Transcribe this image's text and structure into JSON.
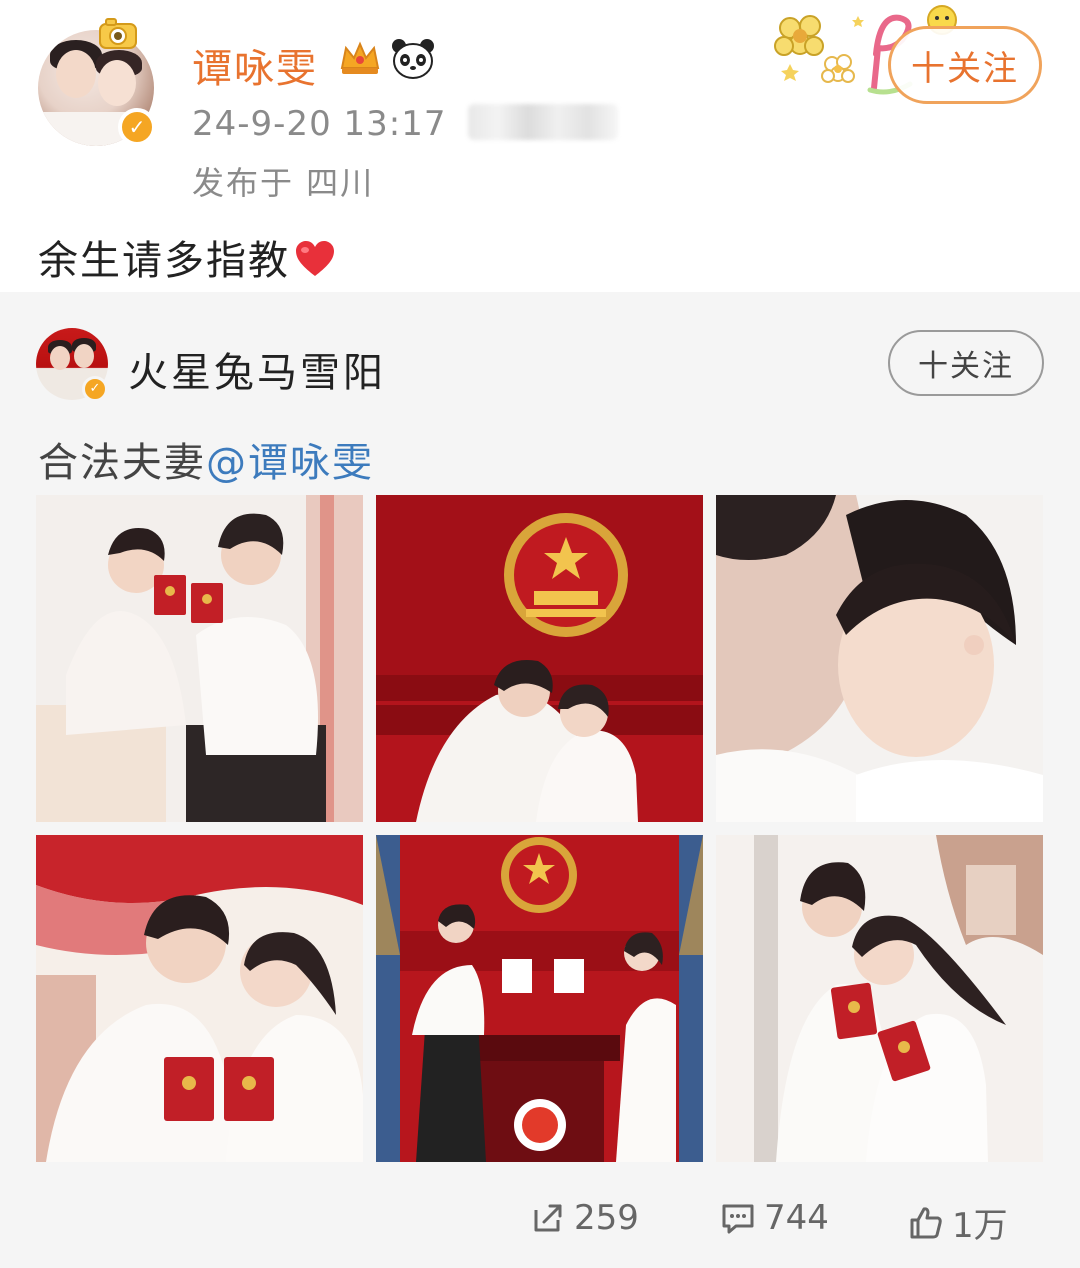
{
  "post": {
    "username": "谭咏雯",
    "timestamp": "24-9-20 13:17",
    "location": "发布于 四川",
    "follow_label": "十关注",
    "caption": "余生请多指教"
  },
  "repost": {
    "username": "火星兔马雪阳",
    "follow_label": "十关注",
    "text_prefix": "合法夫妻",
    "mention": "@谭咏雯"
  },
  "actions": {
    "share_count": "259",
    "comment_count": "744",
    "like_count": "1万"
  },
  "icons": {
    "verified": "verified-badge-icon",
    "crown": "crown-icon",
    "panda": "panda-icon",
    "heart": "heart-icon",
    "share": "share-icon",
    "comment": "comment-icon",
    "like": "thumbs-up-icon"
  },
  "colors": {
    "username_orange": "#e8732f",
    "mention_blue": "#3d7bbd",
    "repost_bg": "#f5f5f5",
    "verified_gold": "#f5a623"
  }
}
